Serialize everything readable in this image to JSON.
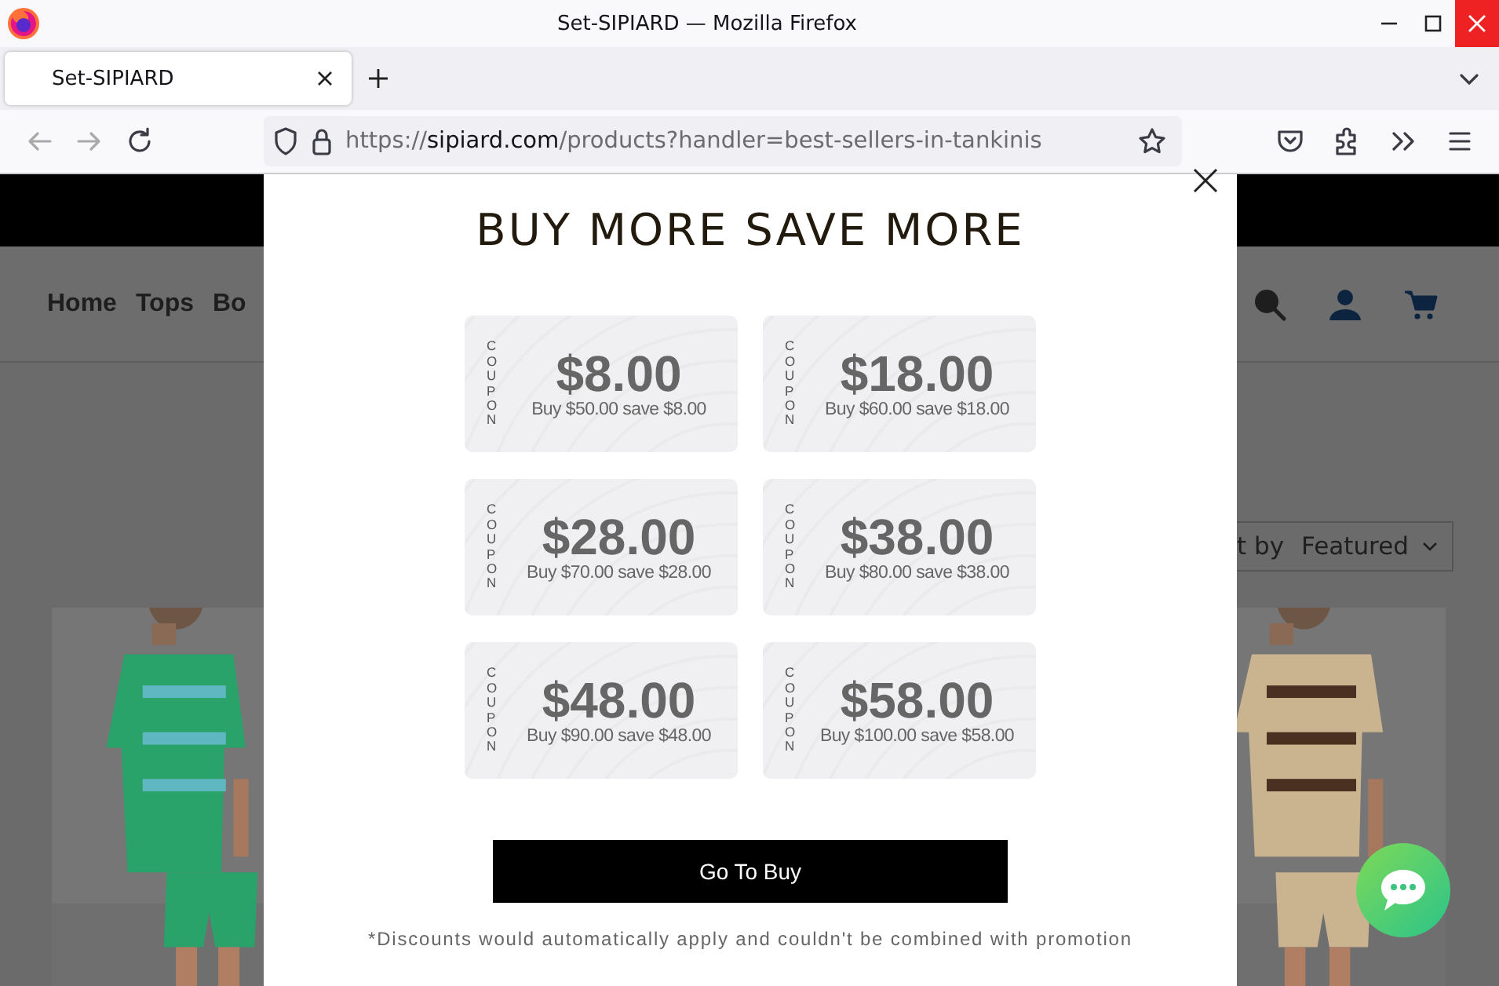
{
  "window": {
    "title": "Set-SIPIARD — Mozilla Firefox"
  },
  "tabs": [
    {
      "title": "Set-SIPIARD",
      "selected": true
    }
  ],
  "address_bar": {
    "scheme": "https://",
    "domain": "sipiard.com",
    "path": "/products?handler=best-sellers-in-tankinis"
  },
  "site_nav": {
    "items": [
      "Home",
      "Tops",
      "Bo"
    ]
  },
  "sort": {
    "label": "t by",
    "value": "Featured"
  },
  "popup": {
    "title": "BUY MORE SAVE MORE",
    "coupons": [
      {
        "label": "COUPON",
        "amount": "$8.00",
        "condition": "Buy $50.00 save $8.00"
      },
      {
        "label": "COUPON",
        "amount": "$18.00",
        "condition": "Buy $60.00 save $18.00"
      },
      {
        "label": "COUPON",
        "amount": "$28.00",
        "condition": "Buy $70.00 save $28.00"
      },
      {
        "label": "COUPON",
        "amount": "$38.00",
        "condition": "Buy $80.00 save $38.00"
      },
      {
        "label": "COUPON",
        "amount": "$48.00",
        "condition": "Buy $90.00 save $48.00"
      },
      {
        "label": "COUPON",
        "amount": "$58.00",
        "condition": "Buy $100.00 save $58.00"
      }
    ],
    "button": "Go To Buy",
    "note": "*Discounts would automatically apply and couldn't be combined with promotion"
  }
}
